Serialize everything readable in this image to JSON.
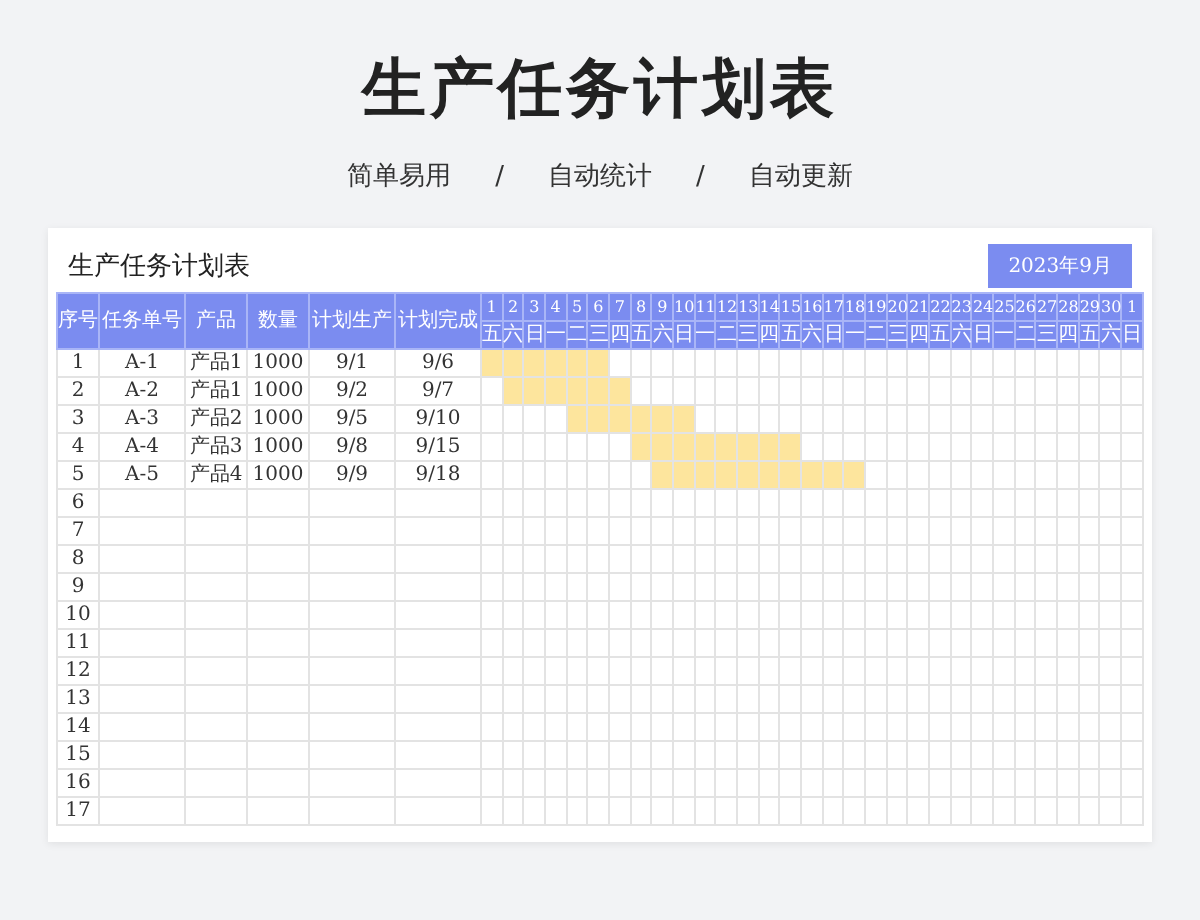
{
  "title": "生产任务计划表",
  "tagline": [
    "简单易用",
    "/",
    "自动统计",
    "/",
    "自动更新"
  ],
  "sheet": {
    "title": "生产任务计划表",
    "month_badge": "2023年9月",
    "columns": [
      "序号",
      "任务单号",
      "产品",
      "数量",
      "计划生产",
      "计划完成"
    ],
    "days": [
      {
        "date": "1",
        "weekday": "五"
      },
      {
        "date": "2",
        "weekday": "六"
      },
      {
        "date": "3",
        "weekday": "日"
      },
      {
        "date": "4",
        "weekday": "一"
      },
      {
        "date": "5",
        "weekday": "二"
      },
      {
        "date": "6",
        "weekday": "三"
      },
      {
        "date": "7",
        "weekday": "四"
      },
      {
        "date": "8",
        "weekday": "五"
      },
      {
        "date": "9",
        "weekday": "六"
      },
      {
        "date": "10",
        "weekday": "日"
      },
      {
        "date": "11",
        "weekday": "一"
      },
      {
        "date": "12",
        "weekday": "二"
      },
      {
        "date": "13",
        "weekday": "三"
      },
      {
        "date": "14",
        "weekday": "四"
      },
      {
        "date": "15",
        "weekday": "五"
      },
      {
        "date": "16",
        "weekday": "六"
      },
      {
        "date": "17",
        "weekday": "日"
      },
      {
        "date": "18",
        "weekday": "一"
      },
      {
        "date": "19",
        "weekday": "二"
      },
      {
        "date": "20",
        "weekday": "三"
      },
      {
        "date": "21",
        "weekday": "四"
      },
      {
        "date": "22",
        "weekday": "五"
      },
      {
        "date": "23",
        "weekday": "六"
      },
      {
        "date": "24",
        "weekday": "日"
      },
      {
        "date": "25",
        "weekday": "一"
      },
      {
        "date": "26",
        "weekday": "二"
      },
      {
        "date": "27",
        "weekday": "三"
      },
      {
        "date": "28",
        "weekday": "四"
      },
      {
        "date": "29",
        "weekday": "五"
      },
      {
        "date": "30",
        "weekday": "六"
      },
      {
        "date": "1",
        "weekday": "日"
      }
    ],
    "rows": [
      {
        "cells": [
          "1",
          "A-1",
          "产品1",
          "1000",
          "9/1",
          "9/6"
        ],
        "bar": [
          true,
          true,
          true,
          true,
          true,
          true,
          false,
          false,
          false,
          false,
          false,
          false,
          false,
          false,
          false,
          false,
          false,
          false,
          false,
          false,
          false,
          false,
          false,
          false,
          false,
          false,
          false,
          false,
          false,
          false,
          false
        ]
      },
      {
        "cells": [
          "2",
          "A-2",
          "产品1",
          "1000",
          "9/2",
          "9/7"
        ],
        "bar": [
          false,
          true,
          true,
          true,
          true,
          true,
          true,
          false,
          false,
          false,
          false,
          false,
          false,
          false,
          false,
          false,
          false,
          false,
          false,
          false,
          false,
          false,
          false,
          false,
          false,
          false,
          false,
          false,
          false,
          false,
          false
        ]
      },
      {
        "cells": [
          "3",
          "A-3",
          "产品2",
          "1000",
          "9/5",
          "9/10"
        ],
        "bar": [
          false,
          false,
          false,
          false,
          true,
          true,
          true,
          true,
          true,
          true,
          false,
          false,
          false,
          false,
          false,
          false,
          false,
          false,
          false,
          false,
          false,
          false,
          false,
          false,
          false,
          false,
          false,
          false,
          false,
          false,
          false
        ]
      },
      {
        "cells": [
          "4",
          "A-4",
          "产品3",
          "1000",
          "9/8",
          "9/15"
        ],
        "bar": [
          false,
          false,
          false,
          false,
          false,
          false,
          false,
          true,
          true,
          true,
          true,
          true,
          true,
          true,
          true,
          false,
          false,
          false,
          false,
          false,
          false,
          false,
          false,
          false,
          false,
          false,
          false,
          false,
          false,
          false,
          false
        ]
      },
      {
        "cells": [
          "5",
          "A-5",
          "产品4",
          "1000",
          "9/9",
          "9/18"
        ],
        "bar": [
          false,
          false,
          false,
          false,
          false,
          false,
          false,
          false,
          true,
          true,
          true,
          true,
          true,
          true,
          true,
          true,
          true,
          true,
          false,
          false,
          false,
          false,
          false,
          false,
          false,
          false,
          false,
          false,
          false,
          false,
          false
        ]
      },
      {
        "cells": [
          "6"
        ]
      },
      {
        "cells": [
          "7"
        ]
      },
      {
        "cells": [
          "8"
        ]
      },
      {
        "cells": [
          "9"
        ]
      },
      {
        "cells": [
          "10"
        ]
      },
      {
        "cells": [
          "11"
        ]
      },
      {
        "cells": [
          "12"
        ]
      },
      {
        "cells": [
          "13"
        ]
      },
      {
        "cells": [
          "14"
        ]
      },
      {
        "cells": [
          "15"
        ]
      },
      {
        "cells": [
          "16"
        ]
      },
      {
        "cells": [
          "17"
        ]
      }
    ]
  }
}
